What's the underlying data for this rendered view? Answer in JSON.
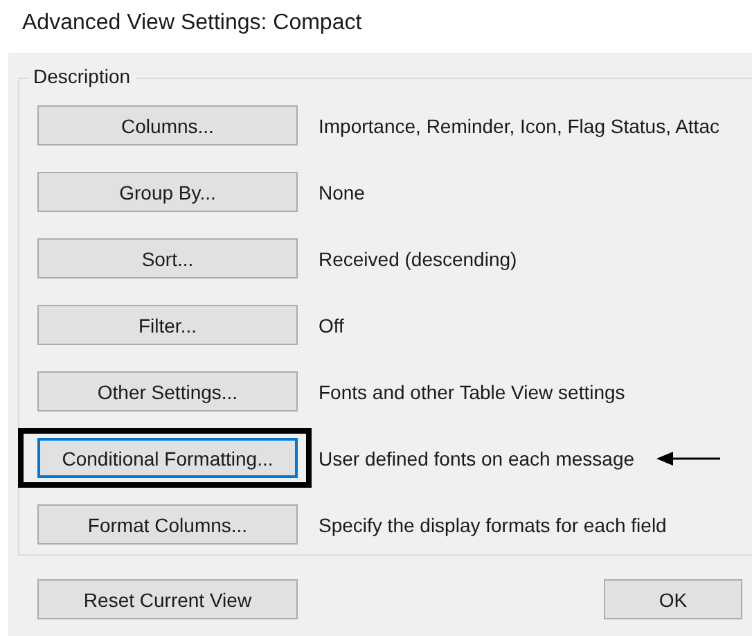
{
  "window": {
    "title": "Advanced View Settings: Compact"
  },
  "group": {
    "label": "Description"
  },
  "rows": [
    {
      "button": "Columns...",
      "description": "Importance, Reminder, Icon, Flag Status, Attac",
      "focused": false,
      "highlighted": false
    },
    {
      "button": "Group By...",
      "description": "None",
      "focused": false,
      "highlighted": false
    },
    {
      "button": "Sort...",
      "description": "Received (descending)",
      "focused": false,
      "highlighted": false
    },
    {
      "button": "Filter...",
      "description": "Off",
      "focused": false,
      "highlighted": false
    },
    {
      "button": "Other Settings...",
      "description": "Fonts and other Table View settings",
      "focused": false,
      "highlighted": false
    },
    {
      "button": "Conditional Formatting...",
      "description": "User defined fonts on each message",
      "focused": true,
      "highlighted": true
    },
    {
      "button": "Format Columns...",
      "description": "Specify the display formats for each field",
      "focused": false,
      "highlighted": false
    }
  ],
  "footer": {
    "buttons": [
      "Reset Current View",
      "OK"
    ]
  }
}
